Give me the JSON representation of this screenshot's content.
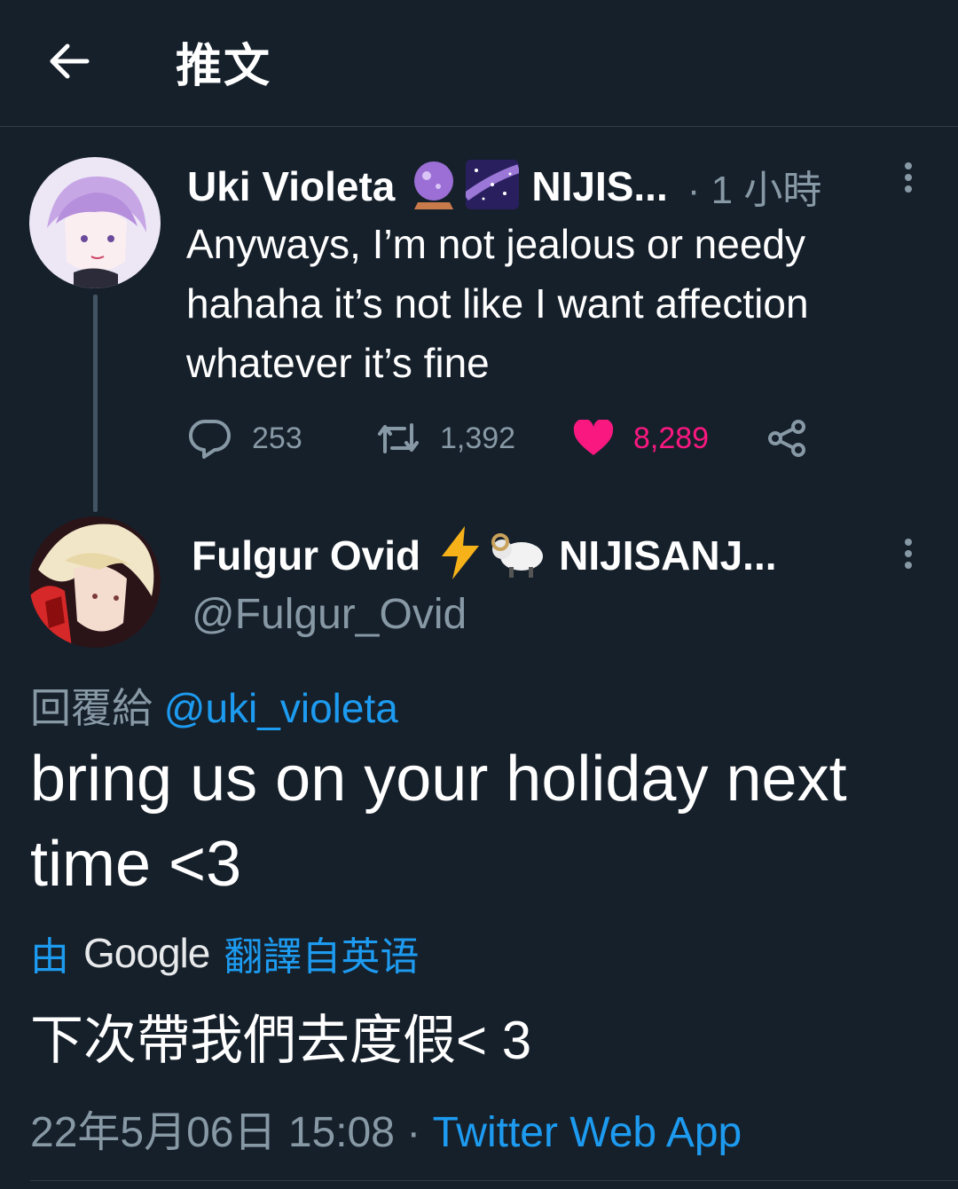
{
  "header": {
    "title": "推文"
  },
  "parent_tweet": {
    "display_name": "Uki Violeta",
    "org": "NIJIS...",
    "time": "· 1 小時",
    "text": "Anyways, I’m not jealous or needy hahaha it’s not like I want affection whatever it’s fine",
    "stats": {
      "replies": "253",
      "retweets": "1,392",
      "likes": "8,289"
    },
    "icons": [
      "crystal-ball-icon",
      "milky-way-icon",
      "reply-icon",
      "retweet-icon",
      "heart-icon",
      "share-icon",
      "more-icon"
    ]
  },
  "reply_tweet": {
    "display_name": "Fulgur Ovid",
    "org": "NIJISANJ...",
    "handle": "@Fulgur_Ovid",
    "replying_to_prefix": "回覆給",
    "replying_to_handle": "@uki_violeta",
    "text": "bring us on your holiday next time <3",
    "translation_prefix": "由",
    "translation_provider": "Google",
    "translation_suffix": "翻譯自英语",
    "translated_text": "下次帶我們去度假< 3",
    "date": "22年5月06日 15:08 ·",
    "source": "Twitter Web App",
    "icons": [
      "lightning-icon",
      "ram-icon",
      "more-icon"
    ]
  },
  "colors": {
    "background": "#16202b",
    "secondary_text": "#8899a6",
    "link": "#1d9bf0",
    "like": "#f91880"
  }
}
